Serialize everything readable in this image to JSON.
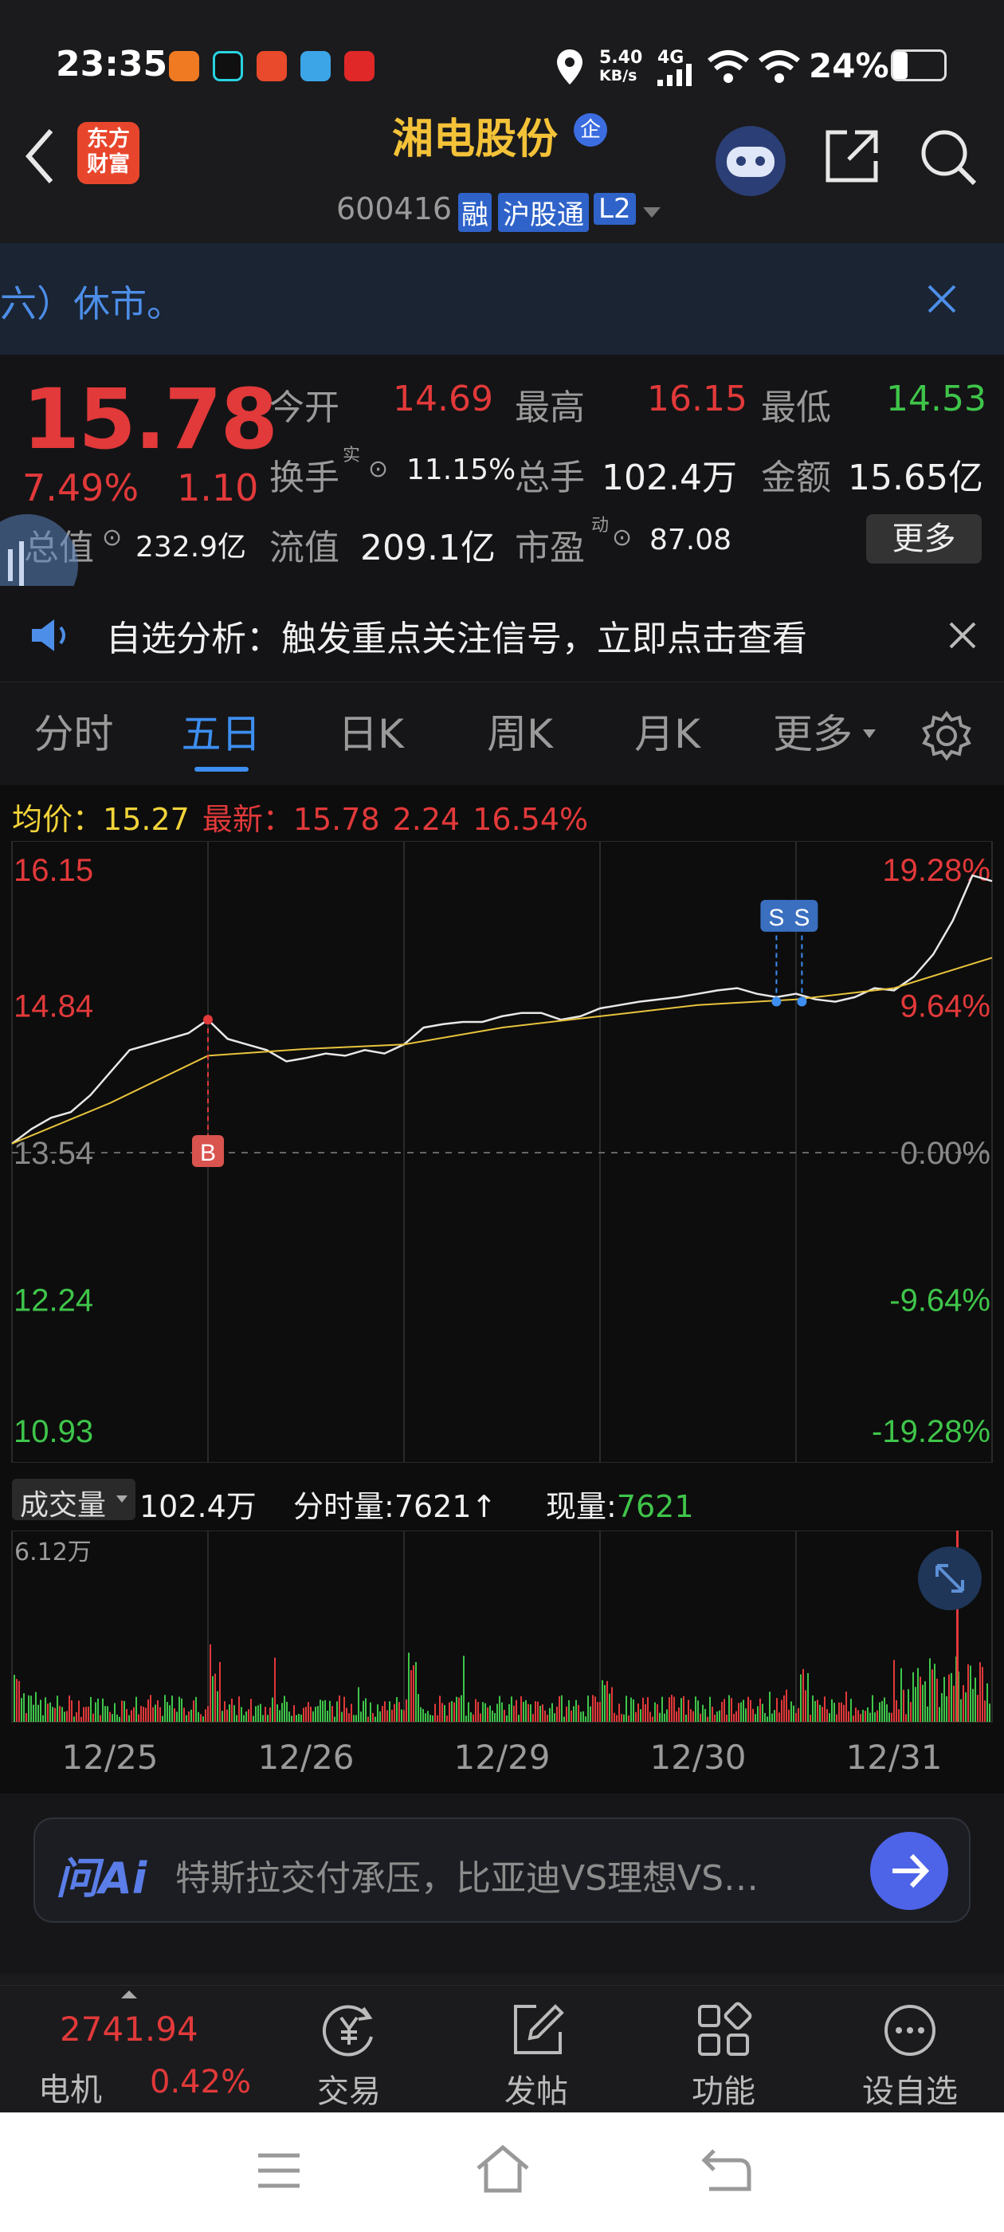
{
  "status_bar": {
    "time": "23:35",
    "net_speed_top": "5.40",
    "net_speed_bottom": "KB/s",
    "network": "4G",
    "battery": "24%"
  },
  "nav": {
    "logo_line1": "东方",
    "logo_line2": "财富",
    "stock_name": "湘电股份",
    "badge": "企",
    "code": "600416",
    "tag_margin": "融",
    "tag_connect": "沪股通",
    "tag_level": "L2"
  },
  "marquee": {
    "text": "六）休市。"
  },
  "quote": {
    "price": "15.78",
    "change_pct": "7.49%",
    "change": "1.10",
    "open_label": "今开",
    "open": "14.69",
    "high_label": "最高",
    "high": "16.15",
    "low_label": "最低",
    "low": "14.53",
    "turnover_label": "换手",
    "turnover_sup": "实",
    "turnover": "11.15%",
    "volume_label": "总手",
    "volume": "102.4万",
    "amount_label": "金额",
    "amount": "15.65亿",
    "mktcap_label": "总值",
    "mktcap": "232.9亿",
    "float_label": "流值",
    "float": "209.1亿",
    "pe_label": "市盈",
    "pe_sup": "动",
    "pe": "87.08",
    "more": "更多"
  },
  "signal": {
    "text": "自选分析：触发重点关注信号，立即点击查看"
  },
  "tabs": {
    "items": [
      "分时",
      "五日",
      "日K",
      "周K",
      "月K",
      "更多"
    ],
    "active": "五日"
  },
  "chart": {
    "avg_label": "均价：",
    "avg": "15.27",
    "latest_label": "最新：",
    "latest": "15.78",
    "latest_change": "2.24",
    "latest_pct": "16.54%",
    "marker_b": "B",
    "marker_s": "S",
    "volume_label": "成交量",
    "volume_total": "102.4万",
    "tick_vol_label": "分时量:",
    "tick_vol": "7621",
    "tick_arrow": "↑",
    "cur_vol_label": "现量:",
    "cur_vol": "7621",
    "vol_max": "6.12万"
  },
  "chart_data": {
    "type": "line",
    "x_labels": [
      "12/25",
      "12/26",
      "12/29",
      "12/30",
      "12/31"
    ],
    "y_ticks_left": [
      "16.15",
      "14.84",
      "13.54",
      "12.24",
      "10.93"
    ],
    "y_ticks_right": [
      "19.28%",
      "9.64%",
      "0.00%",
      "-9.64%",
      "-19.28%"
    ],
    "ylim": [
      10.93,
      16.15
    ],
    "reference_price": 13.54,
    "series": [
      {
        "x": [
          0,
          0.1,
          0.2,
          0.3,
          0.4,
          0.5,
          0.6,
          0.7,
          0.8,
          0.9,
          1.0,
          1.1,
          1.2,
          1.3,
          1.4,
          1.5,
          1.6,
          1.7,
          1.8,
          1.9,
          2.0,
          2.1,
          2.2,
          2.3,
          2.4,
          2.5,
          2.6,
          2.7,
          2.8,
          2.9,
          3.0,
          3.1,
          3.2,
          3.3,
          3.4,
          3.5,
          3.6,
          3.7,
          3.8,
          3.9,
          4.0,
          4.1,
          4.2,
          4.3,
          4.4,
          4.5,
          4.6,
          4.7,
          4.8,
          4.9,
          5.0
        ],
        "values": [
          13.62,
          13.75,
          13.85,
          13.9,
          14.05,
          14.25,
          14.45,
          14.5,
          14.55,
          14.6,
          14.72,
          14.55,
          14.5,
          14.45,
          14.35,
          14.38,
          14.42,
          14.4,
          14.45,
          14.42,
          14.5,
          14.65,
          14.68,
          14.7,
          14.7,
          14.75,
          14.78,
          14.78,
          14.72,
          14.75,
          14.82,
          14.85,
          14.88,
          14.9,
          14.92,
          14.95,
          14.98,
          15.0,
          14.95,
          14.92,
          14.95,
          14.9,
          14.88,
          14.92,
          15.0,
          14.98,
          15.1,
          15.3,
          15.6,
          16.0,
          15.95
        ]
      },
      {
        "x": [
          0,
          0.5,
          1.0,
          1.5,
          2.0,
          2.5,
          3.0,
          3.5,
          4.0,
          4.5,
          5.0
        ],
        "values": [
          13.62,
          13.98,
          14.4,
          14.46,
          14.5,
          14.65,
          14.75,
          14.85,
          14.9,
          15.0,
          15.27
        ]
      }
    ]
  },
  "ai": {
    "logo": "问Ai",
    "text": "特斯拉交付承压，比亚迪VS理想VS…"
  },
  "bottom_nav": {
    "index_value": "2741.94",
    "index_name": "电机",
    "index_pct": "0.42%",
    "trade": "交易",
    "post": "发帖",
    "function": "功能",
    "watch": "设自选"
  }
}
